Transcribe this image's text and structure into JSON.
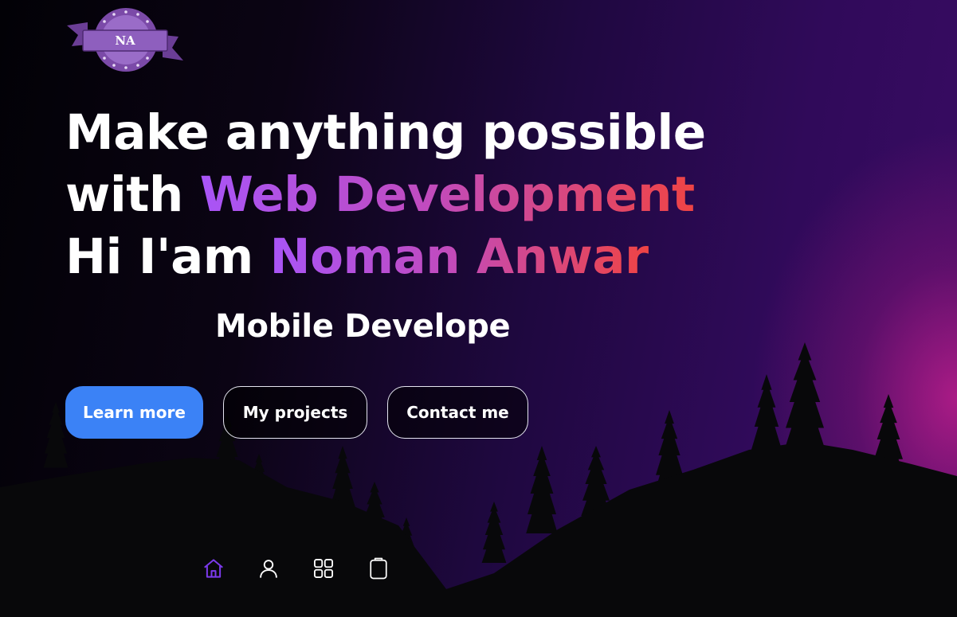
{
  "logo": {
    "text": "NA",
    "colors": {
      "ring": "#7b4aa8",
      "banner": "#8e5fbe",
      "ribbon": "#6b3e96"
    }
  },
  "hero": {
    "line1": "Make anything possible",
    "line2_prefix": "with ",
    "line2_highlight": "Web Development",
    "line3_prefix": "Hi I'am ",
    "line3_highlight": "Noman Anwar"
  },
  "role_text": "Mobile Develope",
  "buttons": {
    "learn_more": "Learn more",
    "my_projects": "My projects",
    "contact_me": "Contact me"
  },
  "nav": [
    {
      "icon": "home-icon",
      "active": true
    },
    {
      "icon": "user-icon",
      "active": false
    },
    {
      "icon": "grid-icon",
      "active": false
    },
    {
      "icon": "clipboard-icon",
      "active": false
    }
  ],
  "colors": {
    "accent_blue": "#3b82f6",
    "gradient_start": "#a855f7",
    "gradient_end": "#ef4444",
    "nav_active": "#7c3aed",
    "nav_inactive": "#ffffff"
  }
}
